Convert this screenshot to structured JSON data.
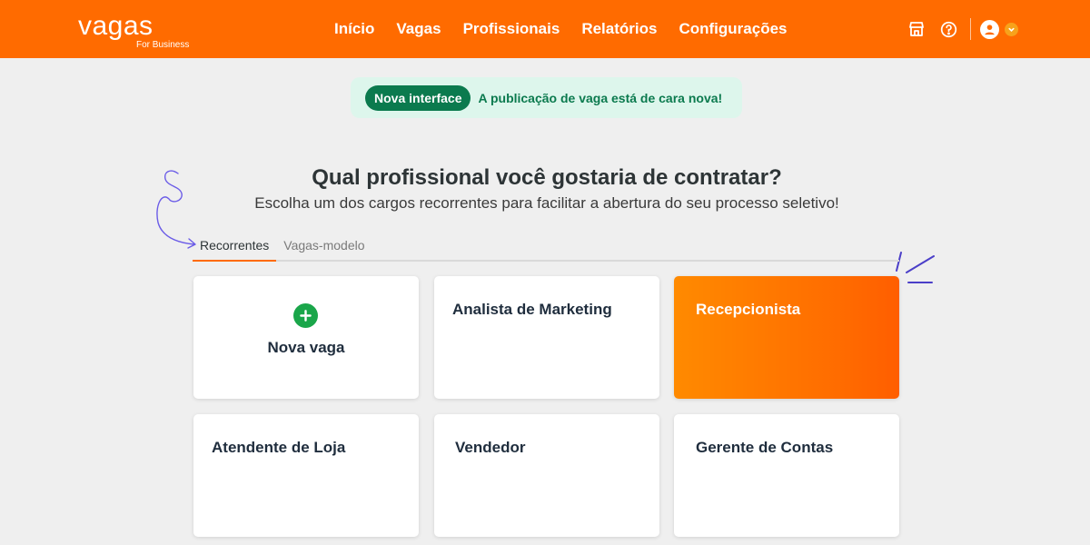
{
  "header": {
    "logo_text": "vagas",
    "logo_sub": "For Business",
    "nav": [
      {
        "label": "Início"
      },
      {
        "label": "Vagas"
      },
      {
        "label": "Profissionais"
      },
      {
        "label": "Relatórios"
      },
      {
        "label": "Configurações"
      }
    ],
    "icons": [
      "store-icon",
      "help-icon",
      "user-icon",
      "chevron-down-icon"
    ],
    "brand_color": "#ff6b00"
  },
  "banner": {
    "pill": "Nova interface",
    "text": "A publicação de vaga está de cara nova!",
    "accent_color": "#0b7a4e"
  },
  "main": {
    "title": "Qual profissional você gostaria de contratar?",
    "subtitle": "Escolha um dos cargos recorrentes para facilitar a abertura do seu processo seletivo!",
    "tabs": [
      {
        "label": "Recorrentes",
        "active": true
      },
      {
        "label": "Vagas-modelo",
        "active": false
      }
    ],
    "new_card_label": "Nova vaga",
    "cards": [
      {
        "label": "Analista de Marketing"
      },
      {
        "label": "Recepcionista",
        "highlighted": true
      },
      {
        "label": "Atendente de Loja"
      },
      {
        "label": "Vendedor"
      },
      {
        "label": "Gerente de Contas"
      }
    ]
  }
}
